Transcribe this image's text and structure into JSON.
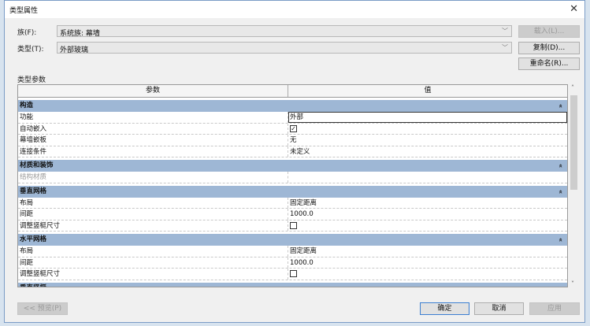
{
  "title": "类型属性",
  "family": {
    "label": "族(F):",
    "value": "系统族: 幕墙"
  },
  "type": {
    "label": "类型(T):",
    "value": "外部玻璃"
  },
  "buttons": {
    "load": "载入(L)...",
    "duplicate": "复制(D)...",
    "rename": "重命名(R)...",
    "preview": "<< 预览(P)",
    "ok": "确定",
    "cancel": "取消",
    "apply": "应用"
  },
  "type_params_label": "类型参数",
  "columns": {
    "param": "参数",
    "value": "值"
  },
  "groups": [
    {
      "name": "构造",
      "rows": [
        {
          "p": "功能",
          "v": "外部"
        },
        {
          "p": "自动嵌入",
          "checked": true
        },
        {
          "p": "幕墙嵌板",
          "v": "无"
        },
        {
          "p": "连接条件",
          "v": "未定义"
        }
      ]
    },
    {
      "name": "材质和装饰",
      "rows": [
        {
          "p": "结构材质",
          "v": ""
        }
      ]
    },
    {
      "name": "垂直网格",
      "rows": [
        {
          "p": "布局",
          "v": "固定距离"
        },
        {
          "p": "间距",
          "v": "1000.0"
        },
        {
          "p": "调整竖梃尺寸",
          "checked": false
        }
      ]
    },
    {
      "name": "水平网格",
      "rows": [
        {
          "p": "布局",
          "v": "固定距离"
        },
        {
          "p": "间距",
          "v": "1000.0"
        },
        {
          "p": "调整竖梃尺寸",
          "checked": false
        }
      ]
    },
    {
      "name": "垂直竖梃",
      "rows": []
    }
  ]
}
